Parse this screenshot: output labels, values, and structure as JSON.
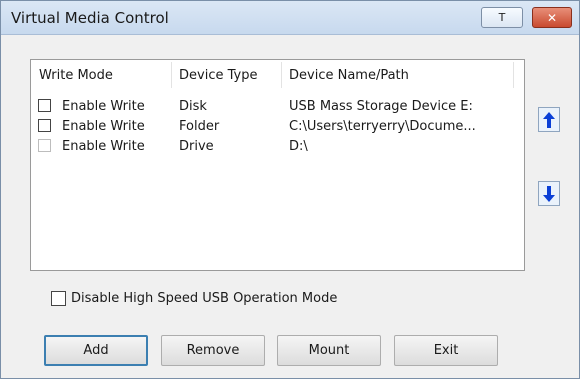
{
  "window": {
    "title": "Virtual Media Control",
    "pin_glyph": "T",
    "close_glyph": "✕"
  },
  "list": {
    "columns": [
      "Write Mode",
      "Device Type",
      "Device Name/Path"
    ],
    "rows": [
      {
        "write": "Enable Write",
        "type": "Disk",
        "name": "USB Mass Storage Device E:",
        "checked": false,
        "enabled": true
      },
      {
        "write": "Enable Write",
        "type": "Folder",
        "name": "C:\\Users\\terryerry\\Docume...",
        "checked": false,
        "enabled": true
      },
      {
        "write": "Enable Write",
        "type": "Drive",
        "name": "D:\\",
        "checked": false,
        "enabled": false
      }
    ]
  },
  "side": {
    "up_icon": "arrow-up-icon",
    "down_icon": "arrow-down-icon",
    "arrow_color": "#0a3fd6"
  },
  "options": {
    "high_speed_label": "Disable High Speed USB Operation Mode",
    "high_speed_checked": false
  },
  "buttons": {
    "add": "Add",
    "remove": "Remove",
    "mount": "Mount",
    "exit": "Exit"
  }
}
